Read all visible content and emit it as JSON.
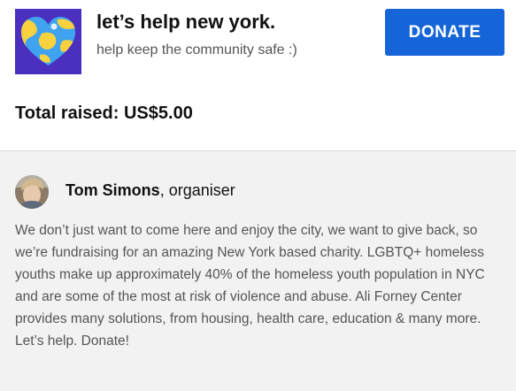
{
  "campaign": {
    "title": "let’s help new york.",
    "subtitle": "help keep the community safe :)",
    "logo_icon": "heart-globe-icon",
    "donate_label": "DONATE",
    "total_raised": "Total raised: US$5.00"
  },
  "organiser": {
    "avatar_icon": "avatar",
    "name": "Tom Simons",
    "role": ", organiser"
  },
  "description": "We don’t just want to come here and enjoy the city, we want to give back, so we’re fundraising for an amazing New York based charity. LGBTQ+ homeless youths make up approximately 40% of the homeless youth population in NYC and are some of the most at risk of violence and abuse. Ali Forney Center provides many solutions, from housing, health care, education & many more. Let’s help. Donate!",
  "colors": {
    "accent": "#1565d8",
    "logo_bg": "#4b2fbe",
    "heart_blue": "#3fa3f0",
    "heart_yellow": "#f7d23e",
    "section_bg": "#f2f2f2"
  }
}
